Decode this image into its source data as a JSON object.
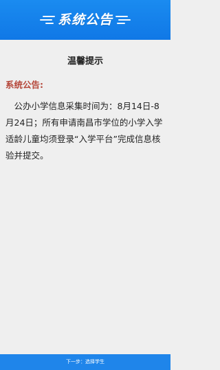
{
  "header": {
    "title": "系统公告"
  },
  "notice": {
    "title": "温馨提示",
    "section_label": "系统公告:",
    "body": "公办小学信息采集时间为：8月14日-8月24日；所有申请南昌市学位的小学入学适龄儿童均须登录“入学平台”完成信息核验并提交。"
  },
  "footer": {
    "next_label": "下一步：选择学生"
  },
  "colors": {
    "header_bg": "#1a8bf0",
    "page_bg": "#efefef",
    "section_label": "#b5473a",
    "footer_bg": "#1f85ea"
  }
}
